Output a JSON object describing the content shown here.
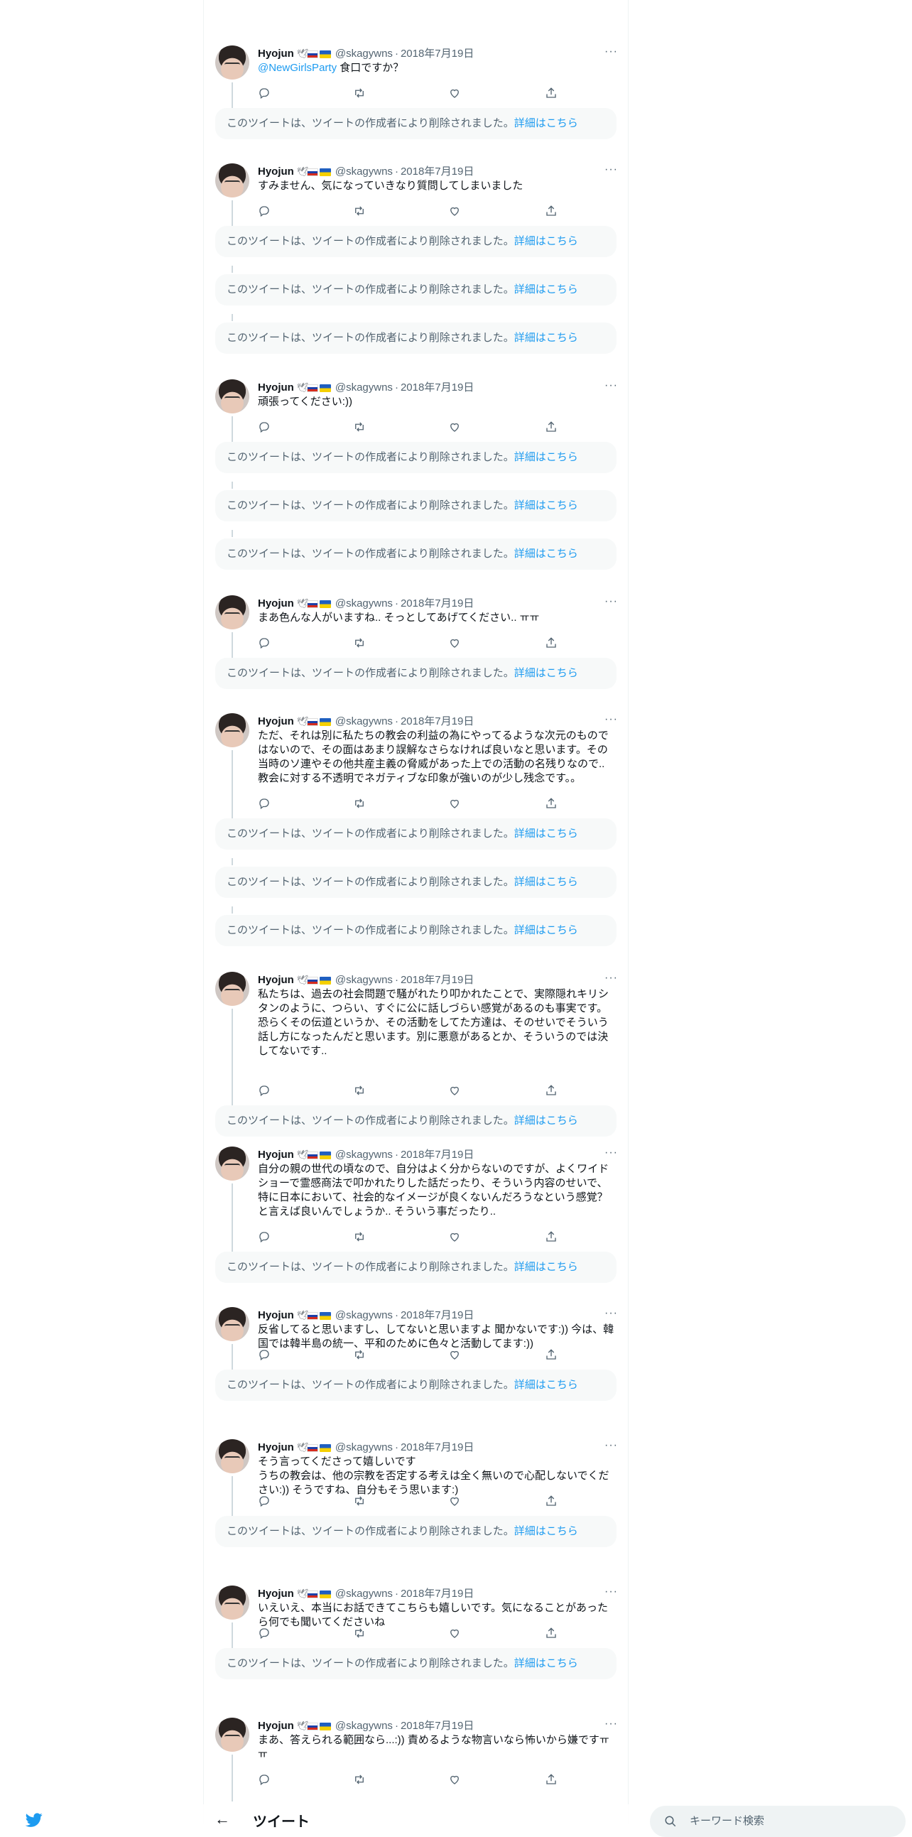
{
  "author": {
    "name": "Hyojun",
    "handle": "@skagywns",
    "separator": "·",
    "date": "2018年7月19日"
  },
  "deleted": {
    "text": "このツイートは、ツイートの作成者により削除されました。",
    "link": "詳細はこちら"
  },
  "more_label": "···",
  "tweets": [
    {
      "mention": "@NewGirlsParty",
      "text": " 食口ですか？"
    },
    {
      "text": "すみません、気になっていきなり質問してしまいました"
    },
    {
      "text": "頑張ってください:))"
    },
    {
      "text": "まあ色んな人がいますね.. そっとしてあげてください.. ㅠㅠ"
    },
    {
      "text": "ただ、それは別に私たちの教会の利益の為にやってるような次元のものではないので、その面はあまり誤解なさらなければ良いなと思います。その当時のソ連やその他共産主義の脅威があった上での活動の名残りなので..教会に対する不透明でネガティブな印象が強いのが少し残念です。。"
    },
    {
      "text": "私たちは、過去の社会問題で騒がれたり叩かれたことで、実際隠れキリシタンのように、つらい、すぐに公に話しづらい感覚があるのも事実です。恐らくその伝道というか、その活動をしてた方達は、そのせいでそういう話し方になったんだと思います。別に悪意があるとか、そういうのでは決してないです.."
    },
    {
      "text": "自分の親の世代の頃なので、自分はよく分からないのですが、よくワイドショーで霊感商法で叩かれたりした話だったり、そういう内容のせいで、特に日本において、社会的なイメージが良くないんだろうなという感覚？と言えば良いんでしょうか.. そういう事だったり.."
    },
    {
      "text": "反省してると思いますし、してないと思いますよ 聞かないです:)) 今は、韓国では韓半島の統一、平和のために色々と活動してます:))"
    },
    {
      "text": "そう言ってくださって嬉しいです\nうちの教会は、他の宗教を否定する考えは全く無いので心配しないでください:)) そうですね、自分もそう思います:)"
    },
    {
      "text": "いえいえ、本当にお話できてこちらも嬉しいです。気になることがあったら何でも聞いてくださいね"
    },
    {
      "text": "まあ、答えられる範囲なら...:)) 責めるような物言いなら怖いから嫌ですㅠㅠ"
    }
  ],
  "header": {
    "back_arrow": "←",
    "title": "ツイート"
  },
  "search": {
    "placeholder": "キーワード検索"
  }
}
